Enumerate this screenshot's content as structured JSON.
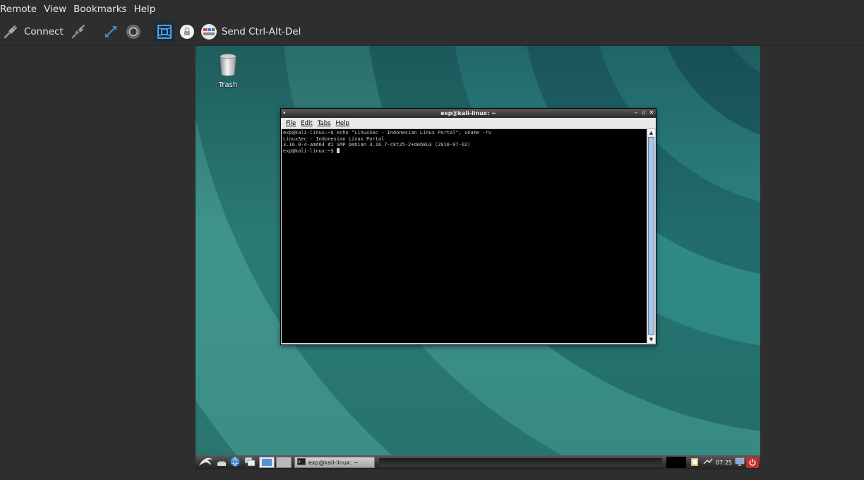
{
  "menubar": {
    "items": [
      {
        "label": "Remote"
      },
      {
        "label": "View"
      },
      {
        "label": "Bookmarks"
      },
      {
        "label": "Help"
      }
    ]
  },
  "toolbar": {
    "connect_icon": "plug-icon",
    "connect_label": "Connect",
    "disconnect_icon": "unplug-icon",
    "fullscreen_icon": "fullscreen-arrows-icon",
    "record_icon": "record-icon",
    "scale_icon": "fit-window-icon",
    "lock_icon": "lock-icon",
    "send_keys_icon": "keyboard-icon",
    "send_keys_label": "Send Ctrl-Alt-Del"
  },
  "desktop": {
    "icons": [
      {
        "label": "Trash",
        "icon": "trash-icon"
      }
    ]
  },
  "terminal": {
    "title": "exp@kali-linux: ~",
    "menu": [
      {
        "label": "File"
      },
      {
        "label": "Edit"
      },
      {
        "label": "Tabs"
      },
      {
        "label": "Help"
      }
    ],
    "lines": [
      "exp@kali-linux:~$ echo \"LinuxSec - Indonesian Linux Portal\"; uname -rv",
      "LinuxSec - Indonesian Linux Portal",
      "3.16.0-4-amd64 #1 SMP Debian 3.16.7-ckt25-2+deb8u3 (2016-07-02)"
    ],
    "prompt": "exp@kali-linux:~$ "
  },
  "taskbar": {
    "task_label": "exp@kali-linux: ~",
    "clock": "07:25"
  },
  "colors": {
    "app_bg": "#2e2e2e",
    "accent_blue": "#3d8fd8",
    "terminal_bg": "#000000",
    "power_red": "#d23a3a"
  }
}
